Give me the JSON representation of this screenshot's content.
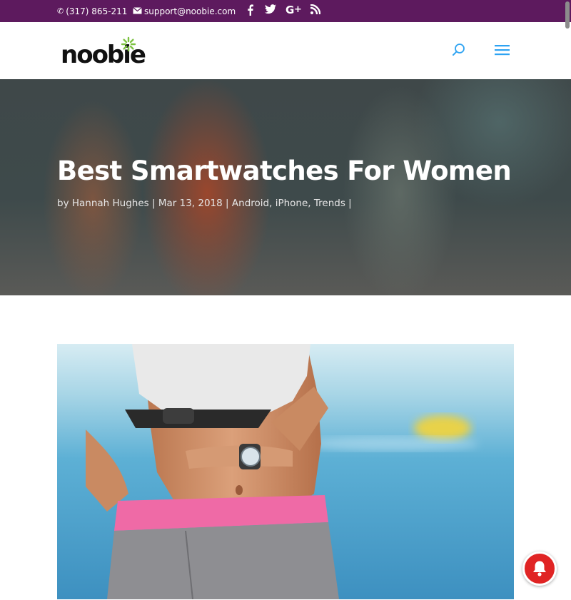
{
  "topbar": {
    "phone": "(317) 865-211",
    "email": "support@noobie.com",
    "phone_icon": "phone-icon",
    "email_icon": "envelope-icon",
    "social": [
      "facebook-icon",
      "twitter-icon",
      "google-plus-icon",
      "rss-icon"
    ],
    "background_color": "#5d1a5e"
  },
  "header": {
    "logo_text": "noobie",
    "logo_accent_color": "#7dc242",
    "search_icon": "search-icon",
    "menu_icon": "hamburger-menu-icon",
    "accent_color": "#2ea3f2"
  },
  "post": {
    "title": "Best Smartwatches For Women",
    "by_label": "by",
    "author": "Hannah Hughes",
    "separator": "|",
    "date": "Mar 13, 2018",
    "categories": [
      "Android",
      "iPhone",
      "Trends"
    ],
    "category_separator": ","
  },
  "feature_image": {
    "icon": "featured-image"
  },
  "notification": {
    "icon": "bell-icon",
    "color": "#e02424"
  }
}
